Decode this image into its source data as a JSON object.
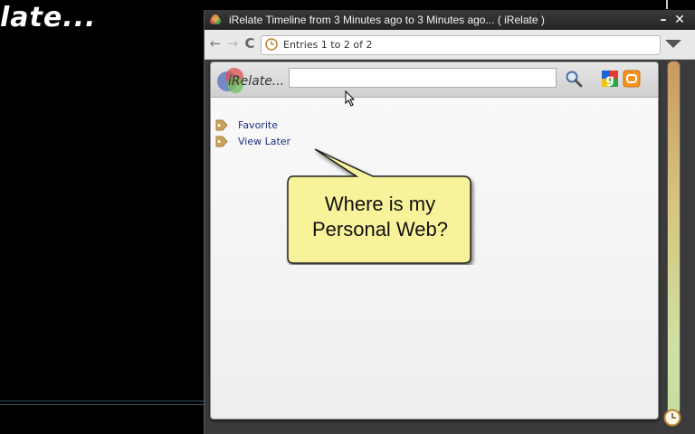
{
  "background": {
    "title_fragment": "late..."
  },
  "window": {
    "title": "iRelate Timeline from 3 Minutes ago to 3 Minutes ago... ( iRelate )",
    "minimize_label": "–",
    "close_label": "✕"
  },
  "navbar": {
    "back_label": "←",
    "forward_label": "→",
    "reload_label": "C",
    "address_text": "Entries 1 to 2 of 2"
  },
  "panel": {
    "logo_text": "iRelate...",
    "search": {
      "value": "",
      "placeholder": ""
    },
    "tags": [
      {
        "label": "Favorite",
        "icon": "tag-icon"
      },
      {
        "label": "View Later",
        "icon": "tag-icon"
      }
    ]
  },
  "callout": {
    "line1": "Where is my",
    "line2": "Personal Web?"
  },
  "colors": {
    "tag_label": "#1c2f80",
    "callout_fill": "#f8f39a",
    "tag_icon": "#c9a35e",
    "timeline_top": "#c99a5f",
    "timeline_bottom": "#c6dfa0"
  }
}
